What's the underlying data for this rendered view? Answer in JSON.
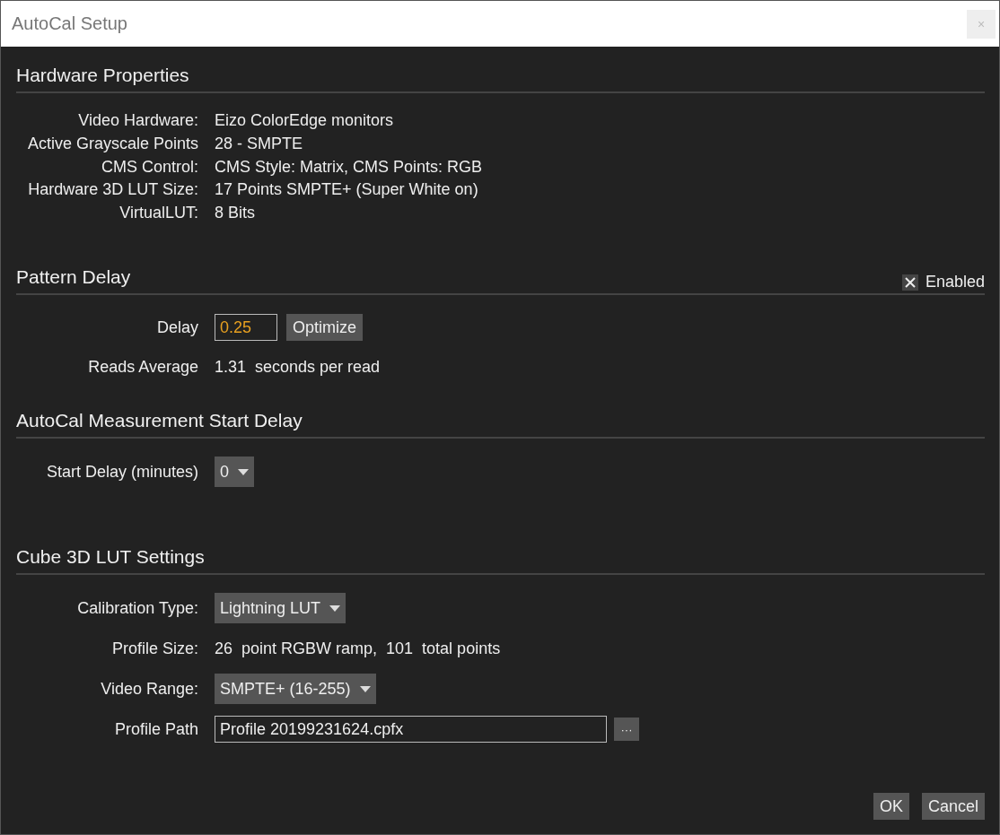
{
  "window": {
    "title": "AutoCal Setup",
    "close": "×"
  },
  "sections": [
    {
      "title": "Hardware Properties",
      "rows": [
        {
          "kind": "info",
          "label": "Video Hardware:",
          "value": "Eizo ColorEdge monitors"
        },
        {
          "kind": "info",
          "label": "Active Grayscale Points",
          "value": "28 - SMPTE"
        },
        {
          "kind": "info",
          "label": "CMS Control:",
          "value": "CMS Style: Matrix, CMS Points: RGB"
        },
        {
          "kind": "info",
          "label": "Hardware 3D LUT Size:",
          "value": "17 Points SMPTE+ (Super White on)"
        },
        {
          "kind": "info",
          "label": "VirtualLUT:",
          "value": "8 Bits"
        }
      ]
    },
    {
      "title": "Pattern Delay",
      "toggle": {
        "label": "Enabled",
        "checked": true
      },
      "rows": [
        {
          "kind": "input",
          "label": "Delay",
          "value": "0.25",
          "button": "Optimize"
        },
        {
          "kind": "text",
          "label": "Reads Average",
          "value": "1.31  seconds per read"
        }
      ]
    },
    {
      "title": "AutoCal Measurement Start Delay",
      "rows": [
        {
          "kind": "dropdown",
          "label": "Start Delay (minutes)",
          "value": "0"
        }
      ]
    },
    {
      "title": "Cube 3D LUT Settings",
      "rows": [
        {
          "kind": "dropdown",
          "label": "Calibration Type:",
          "value": "Lightning LUT"
        },
        {
          "kind": "text",
          "label": "Profile Size:",
          "value": "26  point RGBW ramp,  101  total points"
        },
        {
          "kind": "dropdown",
          "label": "Video Range:",
          "value": "SMPTE+ (16-255)"
        },
        {
          "kind": "path",
          "label": "Profile Path",
          "value": "Profile 20199231624.cpfx",
          "button": "···"
        }
      ]
    }
  ],
  "buttons": [
    "OK",
    "Cancel"
  ]
}
